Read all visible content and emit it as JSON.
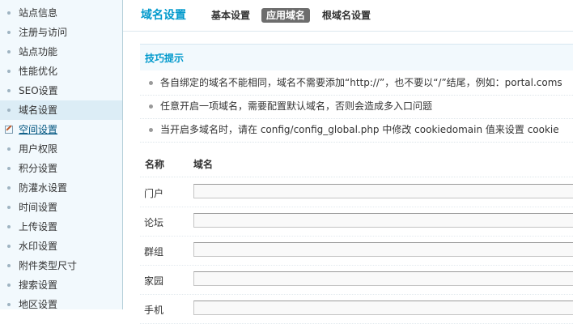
{
  "sidebar": {
    "items": [
      {
        "label": "站点信息",
        "state": "normal"
      },
      {
        "label": "注册与访问",
        "state": "normal"
      },
      {
        "label": "站点功能",
        "state": "normal"
      },
      {
        "label": "性能优化",
        "state": "normal"
      },
      {
        "label": "SEO设置",
        "state": "normal"
      },
      {
        "label": "域名设置",
        "state": "active"
      },
      {
        "label": "空间设置",
        "state": "hover"
      },
      {
        "label": "用户权限",
        "state": "normal"
      },
      {
        "label": "积分设置",
        "state": "normal"
      },
      {
        "label": "防灌水设置",
        "state": "normal"
      },
      {
        "label": "时间设置",
        "state": "normal"
      },
      {
        "label": "上传设置",
        "state": "normal"
      },
      {
        "label": "水印设置",
        "state": "normal"
      },
      {
        "label": "附件类型尺寸",
        "state": "normal"
      },
      {
        "label": "搜索设置",
        "state": "normal"
      },
      {
        "label": "地区设置",
        "state": "normal"
      }
    ]
  },
  "header": {
    "title": "域名设置",
    "tabs": [
      {
        "label": "基本设置",
        "current": false
      },
      {
        "label": "应用域名",
        "current": true
      },
      {
        "label": "根域名设置",
        "current": false
      }
    ]
  },
  "tips": {
    "title": "技巧提示",
    "items": [
      "各自绑定的域名不能相同，域名不需要添加“http://”，也不要以“/”结尾，例如：portal.coms",
      "任意开启一项域名，需要配置默认域名，否则会造成多入口问题",
      "当开启多域名时，请在 config/config_global.php 中修改 cookiedomain 值来设置 cookie"
    ]
  },
  "table": {
    "headers": {
      "name": "名称",
      "domain": "域名"
    },
    "rows": [
      {
        "label": "门户",
        "value": ""
      },
      {
        "label": "论坛",
        "value": ""
      },
      {
        "label": "群组",
        "value": ""
      },
      {
        "label": "家园",
        "value": ""
      },
      {
        "label": "手机",
        "value": ""
      }
    ]
  },
  "colors": {
    "accent": "#0099cc",
    "sidebar_bg": "#f2f9fd",
    "active_item_bg": "#dcedf6",
    "current_tab_bg": "#6d6d6d"
  }
}
